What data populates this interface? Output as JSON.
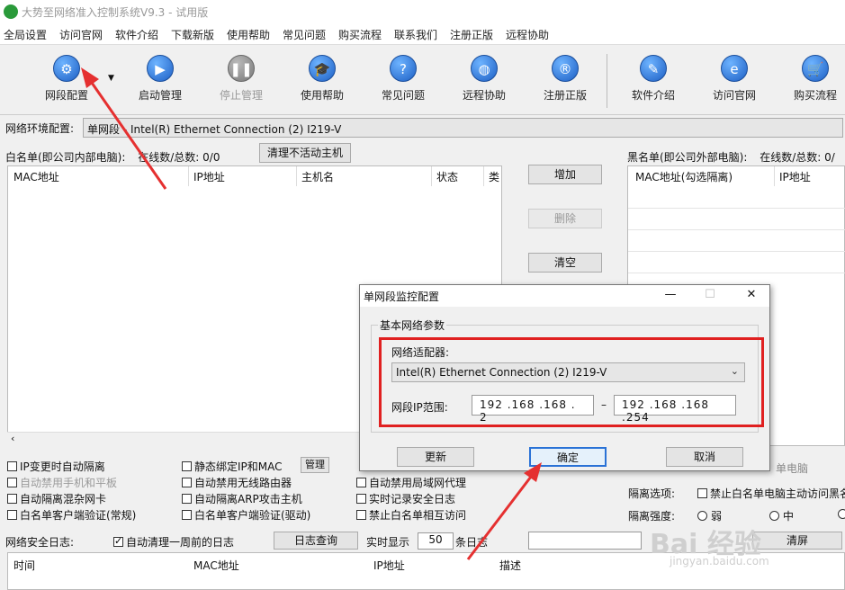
{
  "app": {
    "title": "大势至网络准入控制系统V9.3 - 试用版"
  },
  "menu": [
    "全局设置",
    "访问官网",
    "软件介绍",
    "下载新版",
    "使用帮助",
    "常见问题",
    "购买流程",
    "联系我们",
    "注册正版",
    "远程协助"
  ],
  "toolbar": [
    {
      "label": "网段配置",
      "icon": "gear-icon",
      "glyph": "⚙",
      "disabled": false
    },
    {
      "label": "启动管理",
      "icon": "play-icon",
      "glyph": "▶",
      "disabled": false
    },
    {
      "label": "停止管理",
      "icon": "pause-icon",
      "glyph": "❚❚",
      "disabled": true
    },
    {
      "label": "使用帮助",
      "icon": "graduation-cap-icon",
      "glyph": "🎓",
      "disabled": false
    },
    {
      "label": "常见问题",
      "icon": "question-icon",
      "glyph": "?",
      "disabled": false
    },
    {
      "label": "远程协助",
      "icon": "globe-icon",
      "glyph": "◍",
      "disabled": false
    },
    {
      "label": "注册正版",
      "icon": "registered-icon",
      "glyph": "®",
      "disabled": false
    },
    {
      "label": "软件介绍",
      "icon": "pencil-icon",
      "glyph": "✎",
      "disabled": false
    },
    {
      "label": "访问官网",
      "icon": "browser-icon",
      "glyph": "e",
      "disabled": false
    },
    {
      "label": "购买流程",
      "icon": "cart-icon",
      "glyph": "🛒",
      "disabled": false
    }
  ],
  "network": {
    "label": "网络环境配置:",
    "value": "单网段 - Intel(R) Ethernet Connection (2) I219-V"
  },
  "whitelist": {
    "title": "白名单(即公司内部电脑):",
    "online_label": "在线数/总数:",
    "online_value": "0/0",
    "clear_label": "清理不活动主机",
    "columns": [
      "MAC地址",
      "IP地址",
      "主机名",
      "状态",
      "类"
    ]
  },
  "side_buttons": {
    "add": "增加",
    "delete": "删除",
    "clear": "清空"
  },
  "blacklist": {
    "title": "黑名单(即公司外部电脑):",
    "online_label": "在线数/总数:",
    "online_value": "0/",
    "columns": [
      "MAC地址(勾选隔离)",
      "IP地址"
    ]
  },
  "options": {
    "col1": [
      "IP变更时自动隔离",
      "自动禁用手机和平板",
      "自动隔离混杂网卡",
      "白名单客户端验证(常规)"
    ],
    "col2": [
      "静态绑定IP和MAC",
      "自动禁用无线路由器",
      "自动隔离ARP攻击主机",
      "白名单客户端验证(驱动)"
    ],
    "manage_label": "管理",
    "col3": [
      "自动禁用局域网代理",
      "实时记录安全日志",
      "禁止白名单相互访问"
    ],
    "right_partial": "单电脑",
    "isolation_label": "隔离选项:",
    "isolation_option": "禁止白名单电脑主动访问黑名",
    "strength_label": "隔离强度:",
    "strength_low": "弱",
    "strength_mid": "中"
  },
  "log": {
    "label": "网络安全日志:",
    "autoclear": "自动清理一周前的日志",
    "query": "日志查询",
    "realtime": "实时显示",
    "count": "50",
    "unit": "条日志",
    "clear_screen": "清屏",
    "columns": [
      "时间",
      "MAC地址",
      "IP地址",
      "描述"
    ]
  },
  "dialog": {
    "title": "单网段监控配置",
    "group": "基本网络参数",
    "adapter_label": "网络适配器:",
    "adapter_value": "Intel(R) Ethernet Connection (2) I219-V",
    "range_label": "网段IP范围:",
    "ip_start": "192 .168 .168 . 2",
    "ip_end": "192 .168 .168 .254",
    "refresh": "更新",
    "ok": "确定",
    "cancel": "取消"
  },
  "watermark": {
    "text": "Bai 经验",
    "url": "jingyan.baidu.com"
  },
  "colors": {
    "arrow": "#e53030",
    "highlight": "#e02020",
    "icon_blue": "#1d5fc4"
  }
}
